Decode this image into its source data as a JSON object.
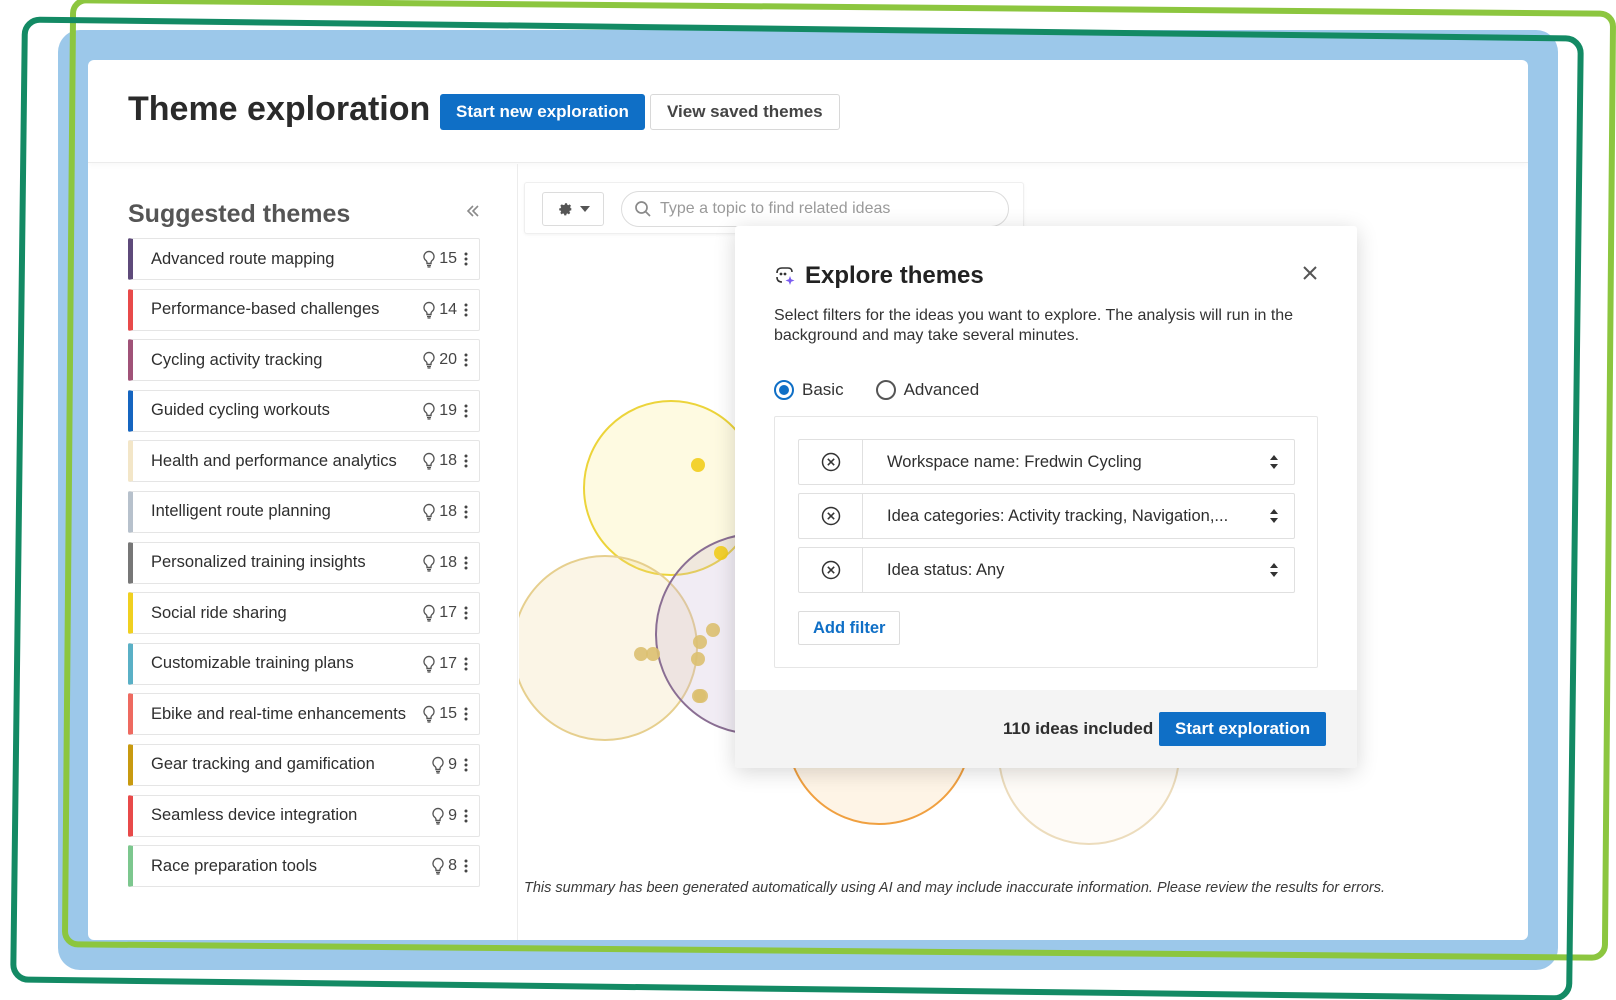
{
  "header": {
    "title": "Theme exploration",
    "start_new_label": "Start new exploration",
    "view_saved_label": "View saved themes"
  },
  "sidebar": {
    "title": "Suggested themes",
    "collapse_icon": "double-chevron-left-icon",
    "themes": [
      {
        "label": "Advanced route mapping",
        "count": "15",
        "color": "#5e4a7a"
      },
      {
        "label": "Performance-based challenges",
        "count": "14",
        "color": "#e84a4a"
      },
      {
        "label": "Cycling activity tracking",
        "count": "20",
        "color": "#a05278"
      },
      {
        "label": "Guided cycling workouts",
        "count": "19",
        "color": "#1565c0"
      },
      {
        "label": "Health and performance analytics",
        "count": "18",
        "color": "#f3e6c8"
      },
      {
        "label": "Intelligent route planning",
        "count": "18",
        "color": "#b7c1cc"
      },
      {
        "label": "Personalized training insights",
        "count": "18",
        "color": "#777777"
      },
      {
        "label": "Social ride sharing",
        "count": "17",
        "color": "#f0d020"
      },
      {
        "label": "Customizable training plans",
        "count": "17",
        "color": "#5ab0c6"
      },
      {
        "label": "Ebike and real-time enhancements",
        "count": "15",
        "color": "#ee6a60"
      },
      {
        "label": "Gear tracking and gamification",
        "count": "9",
        "color": "#c89a10"
      },
      {
        "label": "Seamless device integration",
        "count": "9",
        "color": "#e84a4a"
      },
      {
        "label": "Race preparation tools",
        "count": "8",
        "color": "#7cc78e"
      }
    ]
  },
  "toolbar": {
    "gear_icon": "gear-icon",
    "search_placeholder": "Type a topic to find related ideas"
  },
  "disclaimer": "This summary has been generated automatically using AI and may include inaccurate information. Please review the results for errors.",
  "modal": {
    "title": "Explore themes",
    "description": "Select filters for the ideas you want to explore. The analysis will run in the background and may take several minutes.",
    "radio_basic": "Basic",
    "radio_advanced": "Advanced",
    "selected_mode": "Basic",
    "filters": [
      "Workspace name: Fredwin Cycling",
      "Idea categories: Activity tracking, Navigation,...",
      "Idea status: Any"
    ],
    "add_filter_label": "Add filter",
    "ideas_included": "110 ideas included",
    "start_label": "Start exploration"
  },
  "colors": {
    "accent": "#0f6fc6",
    "frame_blue": "#9cc8ea",
    "frame_lime": "#8cc63f",
    "frame_green": "#138a64"
  }
}
